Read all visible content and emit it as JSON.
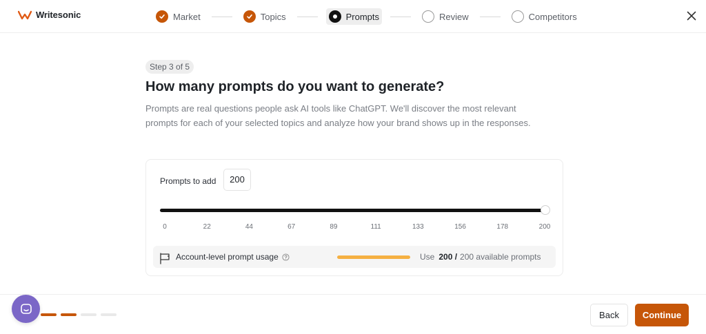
{
  "app": {
    "name": "Writesonic",
    "brand_color": "#c65608"
  },
  "stepper": {
    "steps": [
      {
        "label": "Market",
        "state": "done"
      },
      {
        "label": "Topics",
        "state": "done"
      },
      {
        "label": "Prompts",
        "state": "active"
      },
      {
        "label": "Review",
        "state": "todo"
      },
      {
        "label": "Competitors",
        "state": "todo"
      }
    ]
  },
  "main": {
    "step_badge": "Step 3 of 5",
    "title": "How many prompts do you want to generate?",
    "description": "Prompts are real questions people ask AI tools like ChatGPT. We'll discover the most relevant prompts for each of your selected topics and analyze how your brand shows up in the responses."
  },
  "card": {
    "prompts_label": "Prompts to add",
    "prompts_value": "200",
    "slider": {
      "min": 0,
      "max": 200,
      "value": 200,
      "fill_color": "#111111"
    },
    "ticks": [
      "0",
      "22",
      "44",
      "67",
      "89",
      "111",
      "133",
      "156",
      "178",
      "200"
    ],
    "usage": {
      "label": "Account-level prompt usage",
      "prefix": "Use",
      "used": "200 /",
      "available": "200 available prompts",
      "fraction": 1.0,
      "bar_color": "#f5b042"
    }
  },
  "footer": {
    "progress": {
      "filled": 2,
      "total": 4
    },
    "back_label": "Back",
    "continue_label": "Continue"
  }
}
